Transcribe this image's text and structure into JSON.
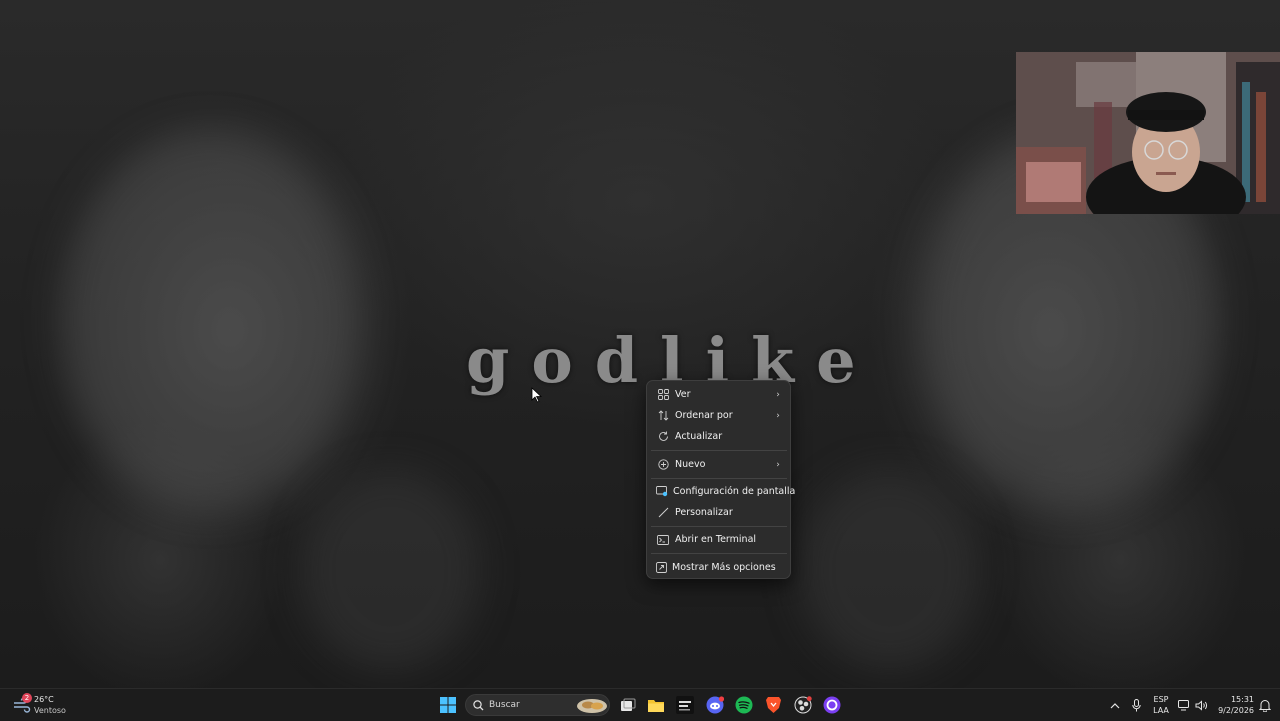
{
  "wallpaper": {
    "logo_text": "godlike"
  },
  "context_menu": {
    "items": [
      {
        "label": "Ver",
        "icon": "grid-icon",
        "submenu": true
      },
      {
        "label": "Ordenar por",
        "icon": "sort-icon",
        "submenu": true
      },
      {
        "label": "Actualizar",
        "icon": "refresh-icon",
        "submenu": false
      },
      {
        "label": "Nuevo",
        "icon": "plus-circle-icon",
        "submenu": true
      },
      {
        "label": "Configuración de pantalla",
        "icon": "display-settings-icon",
        "submenu": false
      },
      {
        "label": "Personalizar",
        "icon": "brush-icon",
        "submenu": false
      },
      {
        "label": "Abrir en Terminal",
        "icon": "terminal-icon",
        "submenu": false
      },
      {
        "label": "Mostrar Más opciones",
        "icon": "expand-icon",
        "submenu": false
      }
    ]
  },
  "taskbar": {
    "weather": {
      "temp": "26°C",
      "condition": "Ventoso",
      "badge": "2"
    },
    "search": {
      "placeholder": "Buscar"
    },
    "pinned_apps": [
      "start-icon",
      "search-icon",
      "task-view-icon",
      "file-explorer-icon",
      "chill-app-icon",
      "discord-icon",
      "spotify-icon",
      "brave-icon",
      "obs-icon",
      "circle-app-icon"
    ],
    "tray": {
      "language_top": "ESP",
      "language_bottom": "LAA",
      "time": "15:31",
      "date": "9/2/2026"
    }
  },
  "colors": {
    "menu_bg": "#2c2c2c",
    "taskbar_bg": "#1c1c1c",
    "spotify": "#1db954",
    "discord": "#5865f2",
    "brave": "#fb542b",
    "windows_blue": "#4cc2ff"
  }
}
